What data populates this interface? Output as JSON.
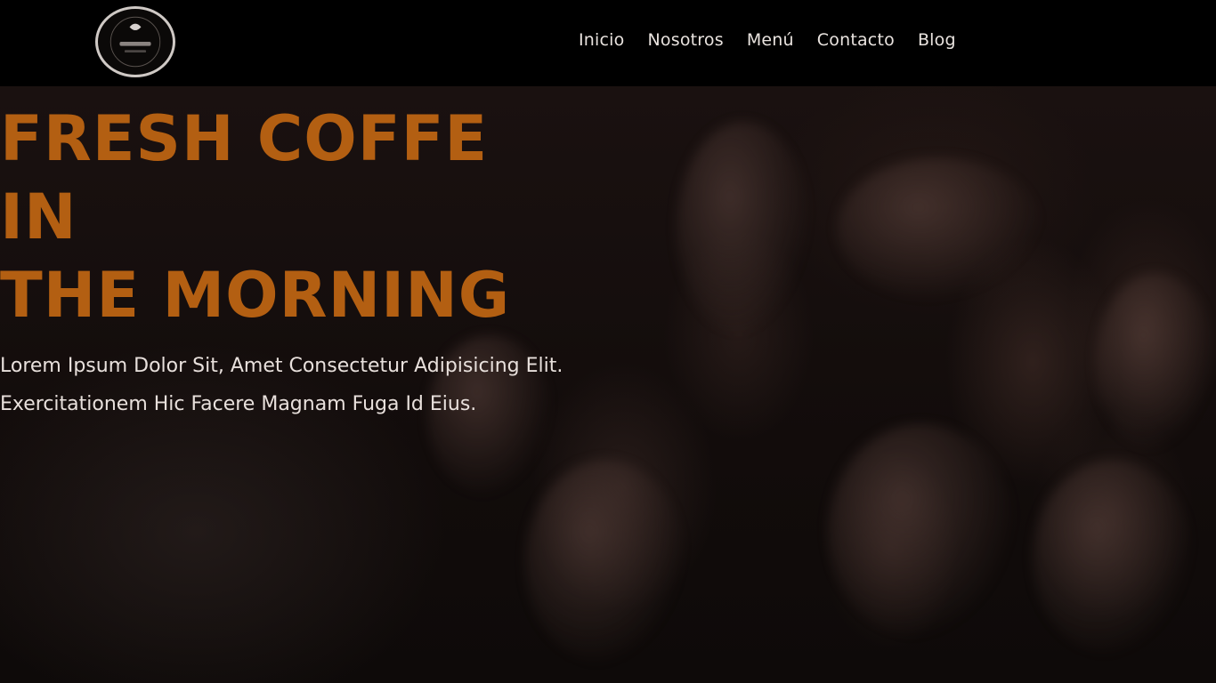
{
  "nav": {
    "links": [
      {
        "label": "Inicio"
      },
      {
        "label": "Nosotros"
      },
      {
        "label": "Menú"
      },
      {
        "label": "Contacto"
      },
      {
        "label": "Blog"
      }
    ]
  },
  "hero": {
    "title_line1": "FRESH COFFE IN",
    "title_line2": "THE MORNING",
    "text_line1": "Lorem Ipsum Dolor Sit, Amet Consectetur Adipisicing Elit.",
    "text_line2": "Exercitationem Hic Facere Magnam Fuga Id Eius."
  },
  "colors": {
    "accent": "#b35f12",
    "navbar_bg": "#000000"
  }
}
